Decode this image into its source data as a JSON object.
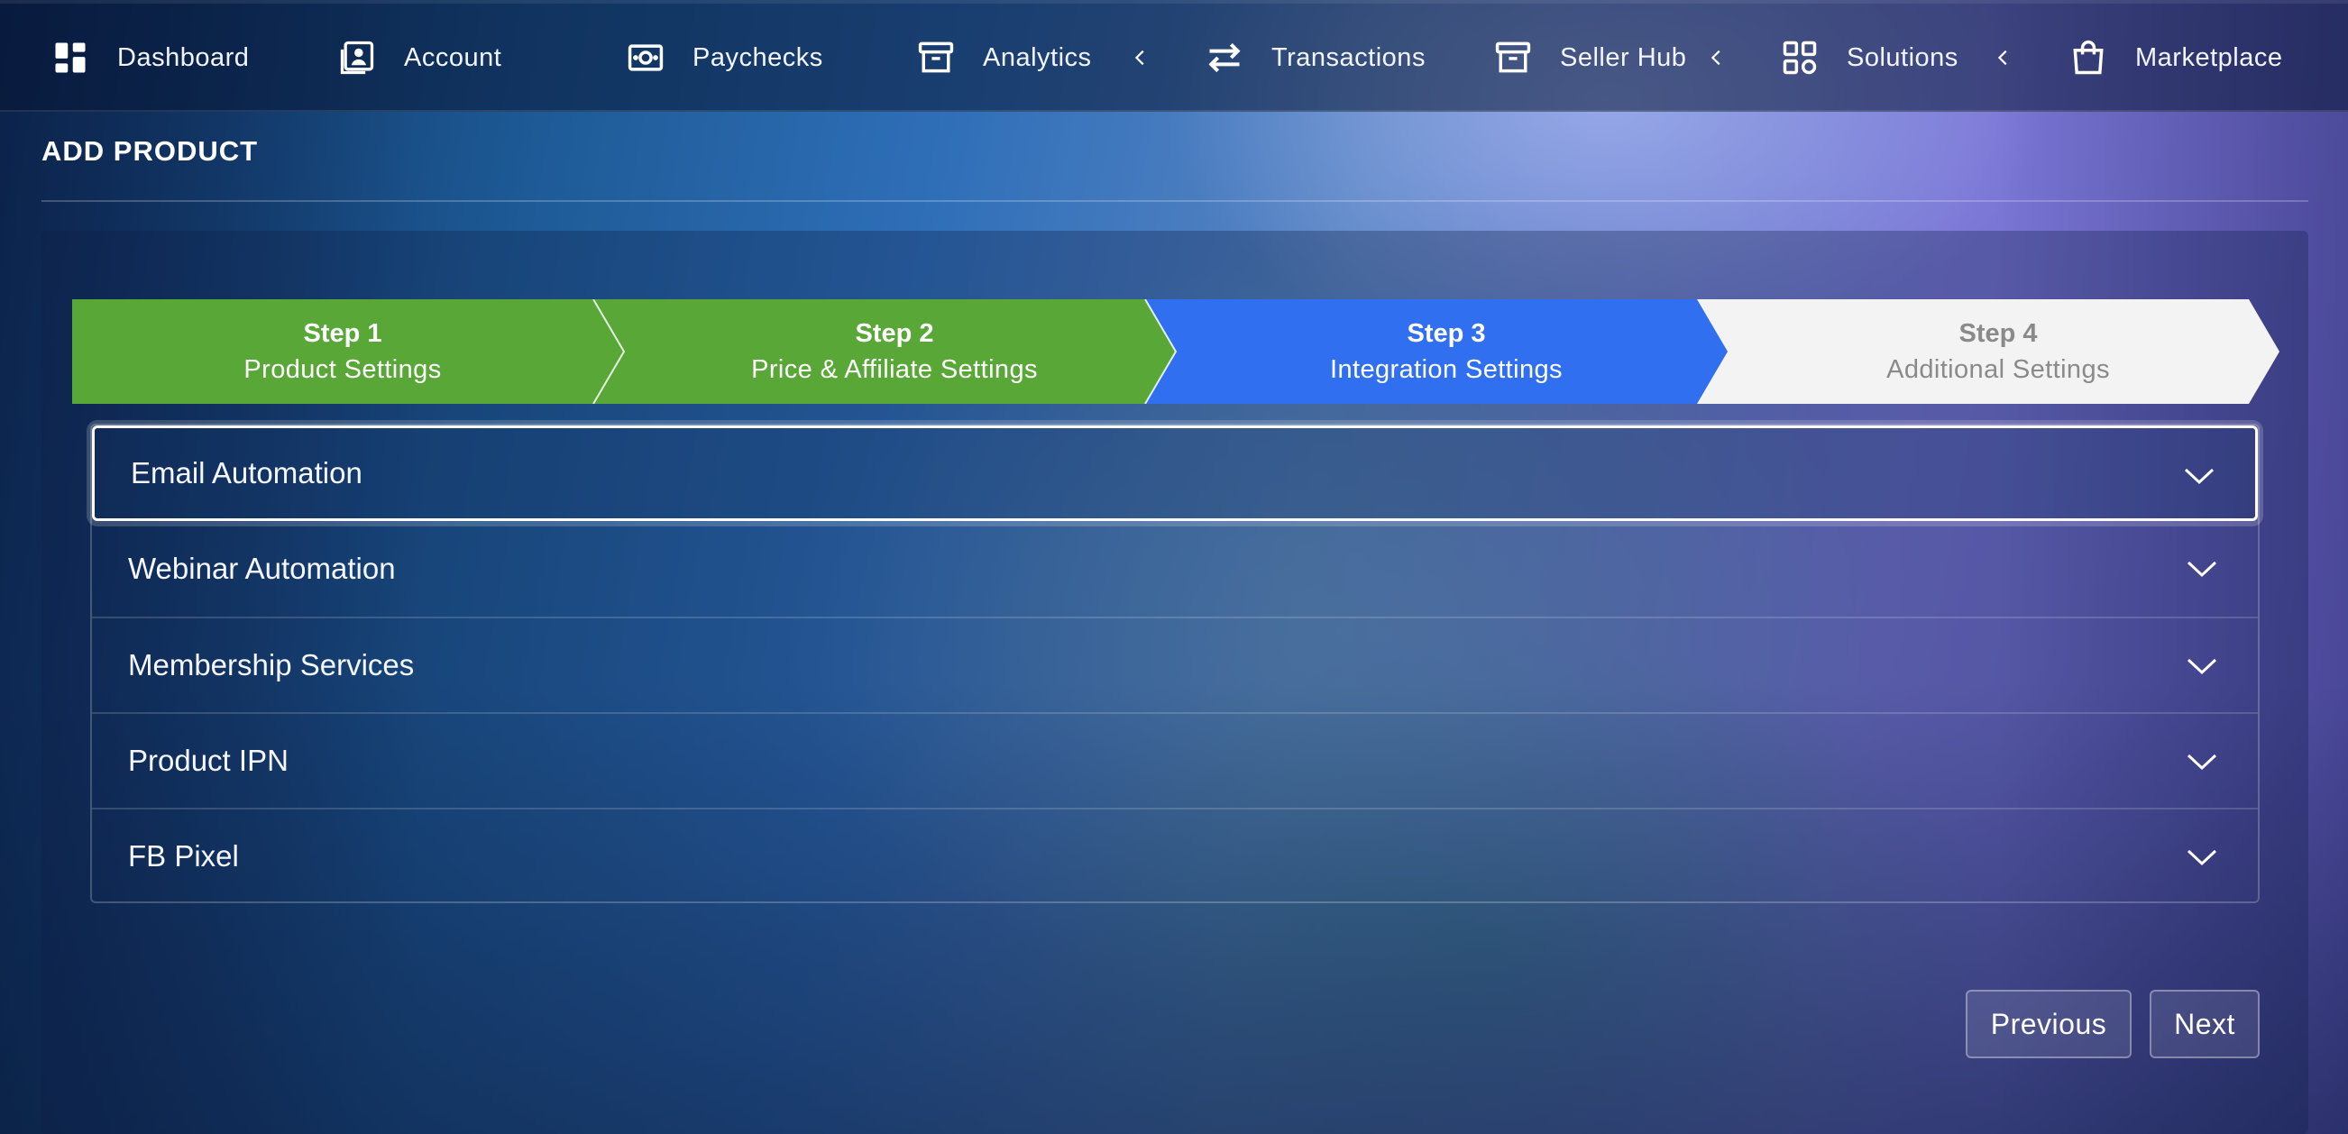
{
  "nav": {
    "items": [
      {
        "label": "Dashboard",
        "icon": "dashboard-icon"
      },
      {
        "label": "Account",
        "icon": "account-icon"
      },
      {
        "label": "Paychecks",
        "icon": "paychecks-icon"
      },
      {
        "label": "Analytics",
        "icon": "archive-icon",
        "has_submenu": true
      },
      {
        "label": "Transactions",
        "icon": "transfer-icon"
      },
      {
        "label": "Seller Hub",
        "icon": "archive-icon",
        "has_submenu": true
      },
      {
        "label": "Solutions",
        "icon": "grid-icon",
        "has_submenu": true
      },
      {
        "label": "Marketplace",
        "icon": "shopping-bag-icon"
      }
    ]
  },
  "page": {
    "title": "ADD PRODUCT"
  },
  "stepper": {
    "steps": [
      {
        "number": "Step 1",
        "label": "Product Settings",
        "state": "completed",
        "color": "#58a737"
      },
      {
        "number": "Step 2",
        "label": "Price & Affiliate Settings",
        "state": "completed",
        "color": "#58a737"
      },
      {
        "number": "Step 3",
        "label": "Integration Settings",
        "state": "active",
        "color": "#2f6ff0"
      },
      {
        "number": "Step 4",
        "label": "Additional Settings",
        "state": "pending",
        "color": "#f3f3f3"
      }
    ]
  },
  "accordion": {
    "sections": [
      {
        "label": "Email Automation",
        "expanded": false,
        "focused": true
      },
      {
        "label": "Webinar Automation",
        "expanded": false
      },
      {
        "label": "Membership Services",
        "expanded": false
      },
      {
        "label": "Product IPN",
        "expanded": false
      },
      {
        "label": "FB Pixel",
        "expanded": false
      }
    ]
  },
  "buttons": {
    "previous": "Previous",
    "next": "Next"
  }
}
